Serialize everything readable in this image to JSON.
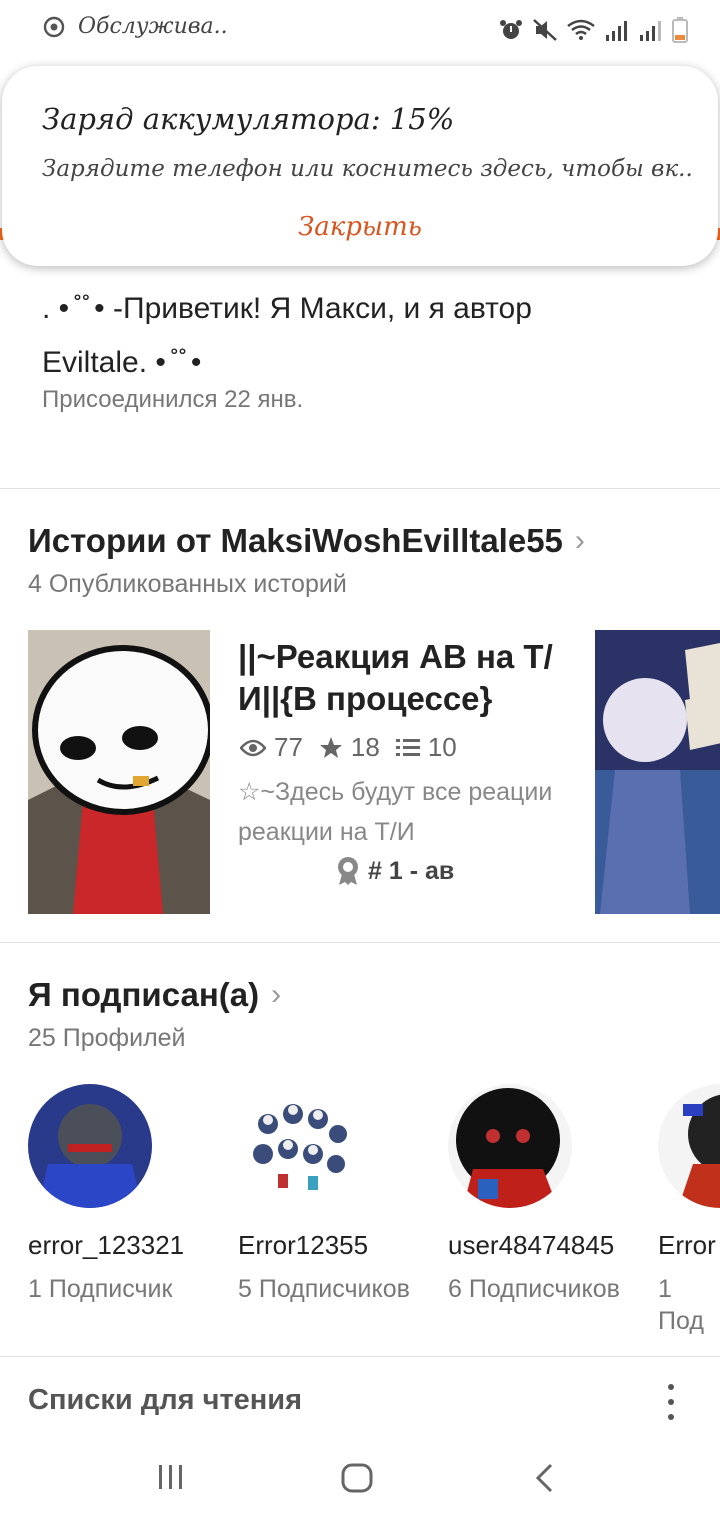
{
  "status_bar": {
    "text": "Обслужива.."
  },
  "notification": {
    "title": "Заряд аккумулятора: 15%",
    "body": "Зарядите телефон или коснитесь здесь, чтобы вк..",
    "close_label": "Закрыть"
  },
  "profile": {
    "bio_line1": ". • ̊  ̊   • -Приветик! Я Макси, и я автор",
    "bio_line2": "Eviltale. • ̊  ̊   •",
    "joined": "Присоединился 22 янв."
  },
  "stories": {
    "title": "Истории от MaksiWoshEvilltale55",
    "subtitle": "4 Опубликованных историй",
    "items": [
      {
        "title": "||~Реакция АВ на Т/И||{В процессе}",
        "views": "77",
        "votes": "18",
        "parts": "10",
        "description": "☆~Здесь будут все реации реакции на Т/И",
        "rank": "# 1 - ав"
      }
    ]
  },
  "following": {
    "title": "Я подписан(а)",
    "subtitle": "25 Профилей",
    "profiles": [
      {
        "name": "error_123321",
        "followers": "1 Подписчик"
      },
      {
        "name": "Error12355",
        "followers": "5 Подписчиков"
      },
      {
        "name": "user48474845",
        "followers": "6 Подписчиков"
      },
      {
        "name": "Error",
        "followers": "1 Под"
      }
    ]
  },
  "reading_lists": {
    "title": "Списки для чтения"
  }
}
